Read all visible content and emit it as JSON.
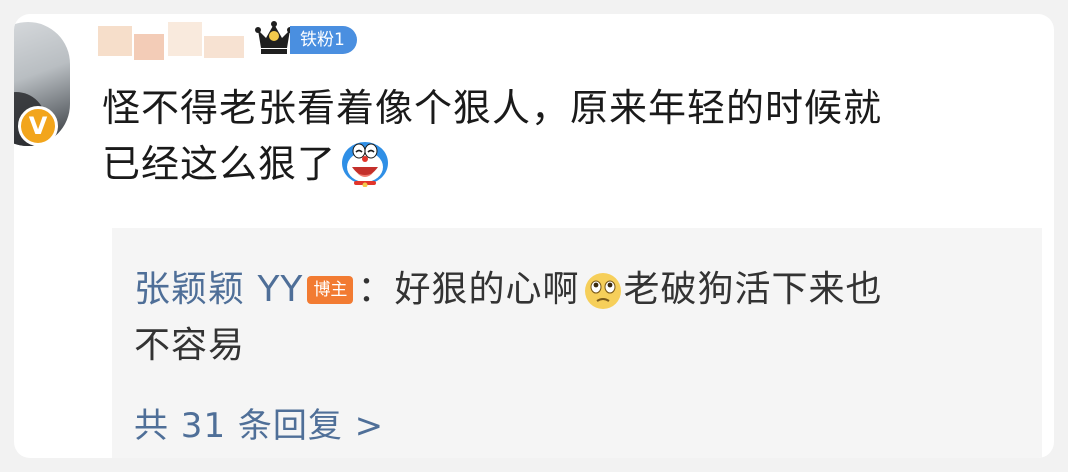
{
  "comment": {
    "fan_badge": "铁粉1",
    "verified_badge": "V",
    "text_line1": "怪不得老张看着像个狠人，原来年轻的时候就",
    "text_line2": "已经这么狠了",
    "emoji_icon": "doraemon-laugh-icon"
  },
  "reply": {
    "author": "张颖颖 YY",
    "host_badge": "博主",
    "separator": "：",
    "text_part1": "好狠的心啊",
    "emoji_icon": "pitiful-face-icon",
    "text_part2": "老破狗活下来也",
    "text_line2": "不容易",
    "more_replies": "共 31 条回复 >"
  },
  "colors": {
    "link_blue": "#4f6f98",
    "fan_badge_blue": "#4a8fe0",
    "host_badge_orange": "#f27b32",
    "verified_orange": "#f2a51c"
  }
}
